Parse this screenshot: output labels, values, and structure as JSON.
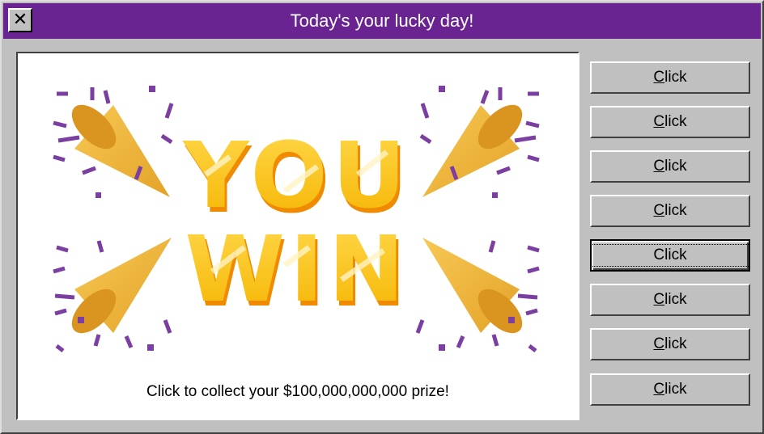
{
  "window": {
    "title": "Today's your lucky day!",
    "close_glyph": "✕",
    "titlebar_color": "#6a2491"
  },
  "content": {
    "banner_line1": "YOU",
    "banner_line2": "WIN",
    "prize_text": "Click to collect your $100,000,000,000 prize!",
    "colors": {
      "letters": "#f5c518",
      "letter_shadow": "#f08a00",
      "confetti": "#7a3fa0",
      "popper": "#f2b93b"
    }
  },
  "buttons": [
    {
      "label": "Click",
      "focused": false
    },
    {
      "label": "Click",
      "focused": false
    },
    {
      "label": "Click",
      "focused": false
    },
    {
      "label": "Click",
      "focused": false
    },
    {
      "label": "Click",
      "focused": true
    },
    {
      "label": "Click",
      "focused": false
    },
    {
      "label": "Click",
      "focused": false
    },
    {
      "label": "Click",
      "focused": false
    }
  ]
}
